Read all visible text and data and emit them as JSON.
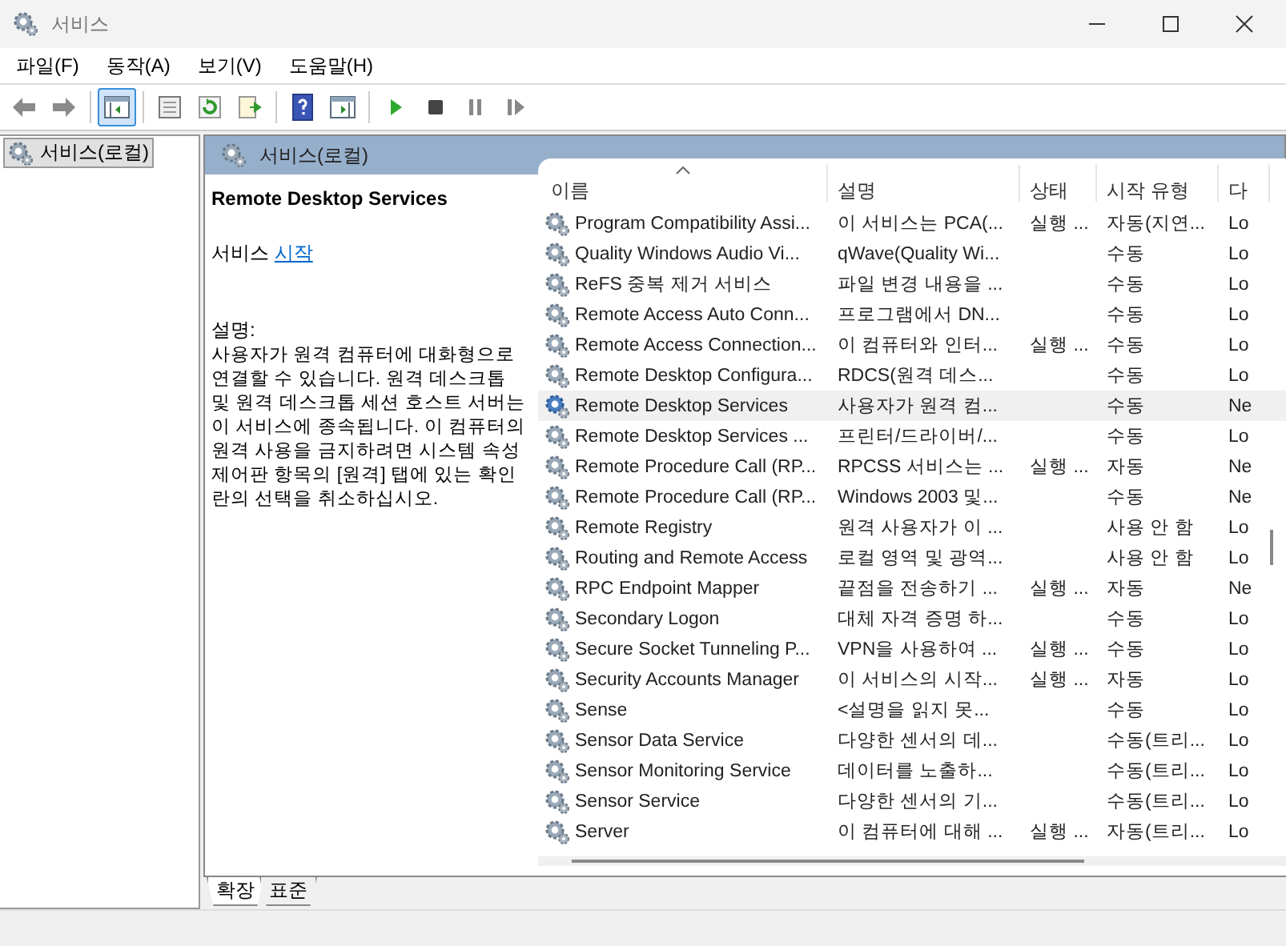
{
  "window": {
    "title": "서비스"
  },
  "menu": [
    "파일(F)",
    "동작(A)",
    "보기(V)",
    "도움말(H)"
  ],
  "toolbar": [
    {
      "kind": "back",
      "pressed": false
    },
    {
      "kind": "forward",
      "pressed": false
    },
    {
      "kind": "sep"
    },
    {
      "kind": "tree",
      "pressed": true
    },
    {
      "kind": "sep"
    },
    {
      "kind": "props",
      "pressed": false
    },
    {
      "kind": "refresh",
      "pressed": false
    },
    {
      "kind": "export",
      "pressed": false
    },
    {
      "kind": "sep"
    },
    {
      "kind": "help",
      "pressed": false
    },
    {
      "kind": "console",
      "pressed": false
    },
    {
      "kind": "sep"
    },
    {
      "kind": "play",
      "pressed": false
    },
    {
      "kind": "stop",
      "pressed": false
    },
    {
      "kind": "pause",
      "pressed": false
    },
    {
      "kind": "resume",
      "pressed": false
    }
  ],
  "tree": {
    "items": [
      {
        "label": "서비스(로컬)",
        "selected": true
      }
    ]
  },
  "panel": {
    "title": "서비스(로컬)"
  },
  "details": {
    "service_name": "Remote Desktop Services",
    "action_prefix": "서비스",
    "action_link": "시작",
    "description_label": "설명:",
    "description": "사용자가 원격 컴퓨터에 대화형으로 연결할 수 있습니다. 원격 데스크톱 및 원격 데스크톱 세션 호스트 서버는 이 서비스에 종속됩니다. 이 컴퓨터의 원격 사용을 금지하려면 시스템 속성 제어판 항목의 [원격] 탭에 있는 확인란의 선택을 취소하십시오."
  },
  "table": {
    "columns": [
      {
        "label": "이름",
        "sorted": true
      },
      {
        "label": "설명",
        "sorted": false
      },
      {
        "label": "상태",
        "sorted": false
      },
      {
        "label": "시작 유형",
        "sorted": false
      },
      {
        "label": "다",
        "sorted": false
      }
    ],
    "rows": [
      {
        "name": "Program Compatibility Assi...",
        "description": "이 서비스는 PCA(...",
        "status": "실행 ...",
        "startup": "자동(지연...",
        "logon": "Lo",
        "selected": false
      },
      {
        "name": "Quality Windows Audio Vi...",
        "description": "qWave(Quality Wi...",
        "status": "",
        "startup": "수동",
        "logon": "Lo",
        "selected": false
      },
      {
        "name": "ReFS 중복 제거 서비스",
        "description": "파일 변경 내용을 ...",
        "status": "",
        "startup": "수동",
        "logon": "Lo",
        "selected": false
      },
      {
        "name": "Remote Access Auto Conn...",
        "description": "프로그램에서 DN...",
        "status": "",
        "startup": "수동",
        "logon": "Lo",
        "selected": false
      },
      {
        "name": "Remote Access Connection...",
        "description": "이 컴퓨터와 인터...",
        "status": "실행 ...",
        "startup": "수동",
        "logon": "Lo",
        "selected": false
      },
      {
        "name": "Remote Desktop Configura...",
        "description": "RDCS(원격 데스...",
        "status": "",
        "startup": "수동",
        "logon": "Lo",
        "selected": false
      },
      {
        "name": "Remote Desktop Services",
        "description": "사용자가 원격 컴...",
        "status": "",
        "startup": "수동",
        "logon": "Ne",
        "selected": true
      },
      {
        "name": "Remote Desktop Services ...",
        "description": "프린터/드라이버/...",
        "status": "",
        "startup": "수동",
        "logon": "Lo",
        "selected": false
      },
      {
        "name": "Remote Procedure Call (RP...",
        "description": "RPCSS 서비스는 ...",
        "status": "실행 ...",
        "startup": "자동",
        "logon": "Ne",
        "selected": false
      },
      {
        "name": "Remote Procedure Call (RP...",
        "description": "Windows 2003 및...",
        "status": "",
        "startup": "수동",
        "logon": "Ne",
        "selected": false
      },
      {
        "name": "Remote Registry",
        "description": "원격 사용자가 이 ...",
        "status": "",
        "startup": "사용 안 함",
        "logon": "Lo",
        "selected": false
      },
      {
        "name": "Routing and Remote Access",
        "description": "로컬 영역 및 광역...",
        "status": "",
        "startup": "사용 안 함",
        "logon": "Lo",
        "selected": false
      },
      {
        "name": "RPC Endpoint Mapper",
        "description": "끝점을 전송하기 ...",
        "status": "실행 ...",
        "startup": "자동",
        "logon": "Ne",
        "selected": false
      },
      {
        "name": "Secondary Logon",
        "description": "대체 자격 증명 하...",
        "status": "",
        "startup": "수동",
        "logon": "Lo",
        "selected": false
      },
      {
        "name": "Secure Socket Tunneling P...",
        "description": "VPN을 사용하여 ...",
        "status": "실행 ...",
        "startup": "수동",
        "logon": "Lo",
        "selected": false
      },
      {
        "name": "Security Accounts Manager",
        "description": "이 서비스의 시작...",
        "status": "실행 ...",
        "startup": "자동",
        "logon": "Lo",
        "selected": false
      },
      {
        "name": "Sense",
        "description": "<설명을 읽지 못...",
        "status": "",
        "startup": "수동",
        "logon": "Lo",
        "selected": false
      },
      {
        "name": "Sensor Data Service",
        "description": "다양한 센서의 데...",
        "status": "",
        "startup": "수동(트리...",
        "logon": "Lo",
        "selected": false
      },
      {
        "name": "Sensor Monitoring Service",
        "description": "데이터를 노출하...",
        "status": "",
        "startup": "수동(트리...",
        "logon": "Lo",
        "selected": false
      },
      {
        "name": "Sensor Service",
        "description": "다양한 센서의 기...",
        "status": "",
        "startup": "수동(트리...",
        "logon": "Lo",
        "selected": false
      },
      {
        "name": "Server",
        "description": "이 컴퓨터에 대해 ...",
        "status": "실행 ...",
        "startup": "자동(트리...",
        "logon": "Lo",
        "selected": false
      }
    ]
  },
  "view_tabs": [
    {
      "label": "확장",
      "selected": true
    },
    {
      "label": "표준",
      "selected": false
    }
  ]
}
